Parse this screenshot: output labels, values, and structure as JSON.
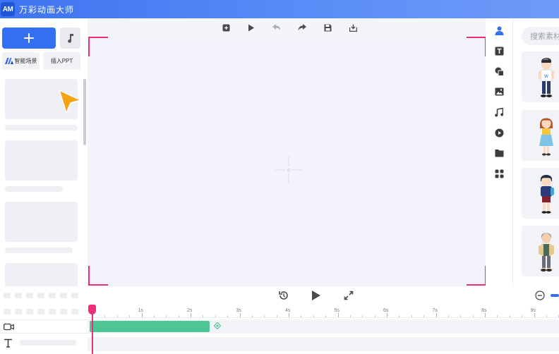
{
  "app": {
    "logo_text": "AM",
    "title": "万彩动画大师"
  },
  "left_panel": {
    "add_scene_label": "+",
    "smart_scene_label": "智能场景",
    "insert_ppt_label": "插入PPT"
  },
  "right_panel": {
    "search_placeholder": "搜索素材"
  },
  "timeline": {
    "ticks": [
      "1s",
      "2s",
      "3s",
      "4s",
      "5s",
      "6s",
      "7s",
      "8s",
      "9s"
    ]
  },
  "colors": {
    "accent": "#3470f2",
    "stage_corner": "#ef2d7a",
    "clip": "#4dc594",
    "playhead": "#ef2d7a",
    "cursor": "#f5a312"
  },
  "icons": {
    "toolbar": [
      "add-icon",
      "play-icon",
      "undo-icon",
      "redo-icon",
      "save-icon",
      "export-icon"
    ],
    "right_tools": [
      "character-icon",
      "text-icon",
      "shape-icon",
      "image-icon",
      "music-icon",
      "video-icon",
      "folder-icon",
      "apps-icon"
    ]
  }
}
